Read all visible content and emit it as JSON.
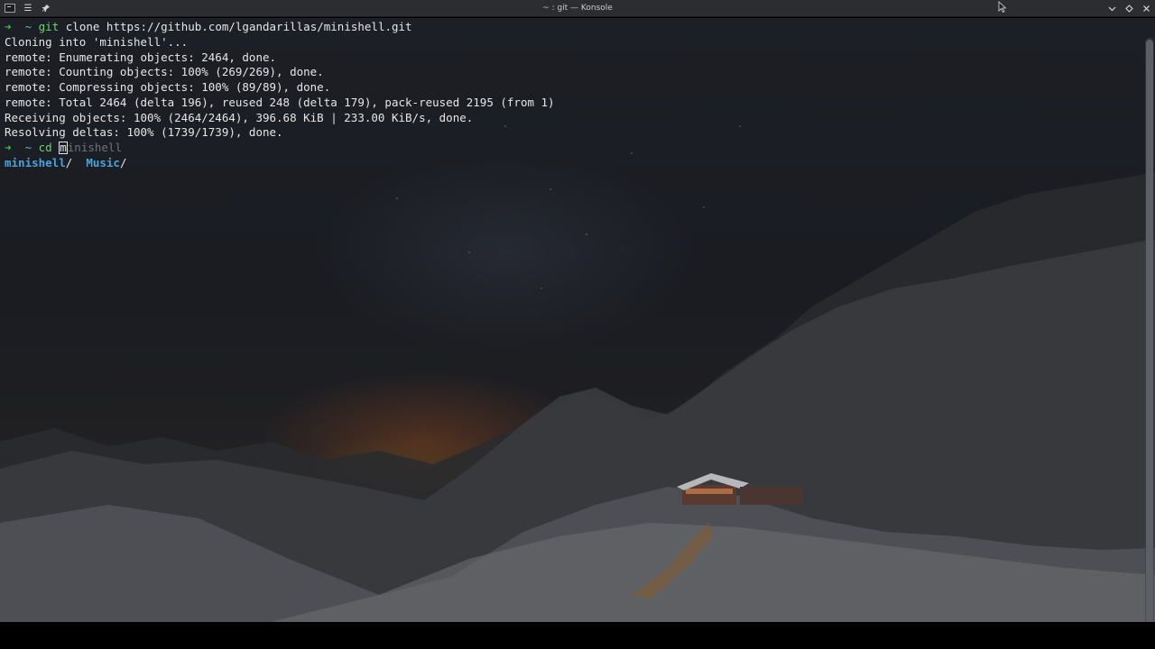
{
  "window": {
    "title": "~ : git — Konsole",
    "menu_icon": "hamburger-menu-icon",
    "pin_icon": "pin-icon",
    "controls": [
      "minimize-icon",
      "maximize-icon",
      "close-icon"
    ]
  },
  "terminal": {
    "line1": {
      "prompt_arrow": "➜",
      "dir": "~",
      "cmd": "git",
      "args": "clone https://github.com/lgandarillas/minishell.git"
    },
    "output": [
      "Cloning into 'minishell'...",
      "remote: Enumerating objects: 2464, done.",
      "remote: Counting objects: 100% (269/269), done.",
      "remote: Compressing objects: 100% (89/89), done.",
      "remote: Total 2464 (delta 196), reused 248 (delta 179), pack-reused 2195 (from 1)",
      "Receiving objects: 100% (2464/2464), 396.68 KiB | 233.00 KiB/s, done.",
      "Resolving deltas: 100% (1739/1739), done."
    ],
    "line9": {
      "prompt_arrow": "➜",
      "dir": "~",
      "cmd": "cd",
      "typed": "m",
      "suggestion": "inishell"
    },
    "completions": [
      "minishell",
      "/",
      "Music",
      "/"
    ]
  },
  "colors": {
    "prompt_arrow": "#3fbf4a",
    "tilde": "#58b9b9",
    "command": "#6cd36b",
    "directory": "#4aa3d9",
    "suggestion": "#6f7378"
  }
}
